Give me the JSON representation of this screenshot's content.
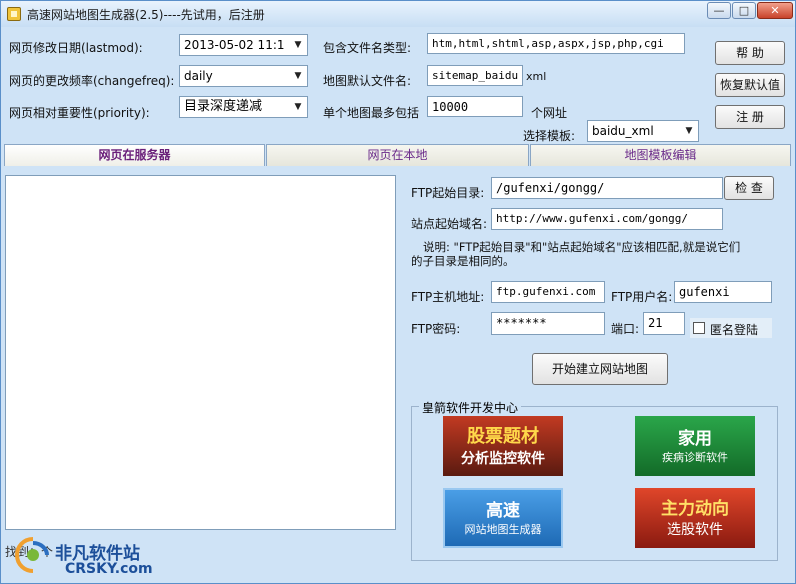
{
  "window": {
    "title": "高速网站地图生成器(2.5)----先试用，后注册",
    "min_glyph": "—",
    "max_glyph": "□",
    "close_glyph": "✕"
  },
  "form": {
    "lastmod_label": "网页修改日期(lastmod):",
    "lastmod_value": "2013-05-02 11:1",
    "changefreq_label": "网页的更改频率(changefreq):",
    "changefreq_value": "daily",
    "priority_label": "网页相对重要性(priority):",
    "priority_value": "目录深度递减",
    "include_types_label": "包含文件名类型:",
    "include_types_value": "htm,html,shtml,asp,aspx,jsp,php,cgi",
    "default_filename_label": "地图默认文件名:",
    "default_filename_value": "sitemap_baidu",
    "default_filename_ext": "xml",
    "max_urls_label": "单个地图最多包括",
    "max_urls_value": "10000",
    "max_urls_unit": "个网址",
    "template_label": "选择模板:",
    "template_value": "baidu_xml"
  },
  "side_buttons": {
    "help": "帮 助",
    "restore": "恢复默认值",
    "register": "注 册"
  },
  "tabs": [
    {
      "label": "网页在服务器"
    },
    {
      "label": "网页在本地"
    },
    {
      "label": "地图模板编辑"
    }
  ],
  "ftp": {
    "start_dir_label": "FTP起始目录:",
    "start_dir_value": "/gufenxi/gongg/",
    "check_button": "检 查",
    "site_domain_label": "站点起始域名:",
    "site_domain_value": "http://www.gufenxi.com/gongg/",
    "note_line1": "说明: \"FTP起始目录\"和\"站点起始域名\"应该相匹配,就是说它们",
    "note_line2": "的子目录是相同的。",
    "host_label": "FTP主机地址:",
    "host_value": "ftp.gufenxi.com",
    "user_label": "FTP用户名:",
    "user_value": "gufenxi",
    "password_label": "FTP密码:",
    "password_value": "*******",
    "port_label": "端口:",
    "port_value": "21",
    "anonymous_label": "匿名登陆",
    "anonymous_checked": false,
    "start_button": "开始建立网站地图"
  },
  "ads": {
    "group_title": "皇箭软件开发中心",
    "stock": {
      "line1": "股票题材",
      "line2": "分析监控软件",
      "color": "#a1281a"
    },
    "home": {
      "line1": "家用",
      "line2": "疾病诊断软件",
      "color": "#1f8f3a"
    },
    "sitemap": {
      "line1": "高速",
      "line2": "网站地图生成器",
      "color": "#2e7fc9"
    },
    "trend": {
      "line1": "主力动向",
      "line2": "选股软件",
      "color": "#c4301e"
    }
  },
  "status": {
    "text": "找到：个"
  },
  "watermark": {
    "line1": "非凡软件站",
    "line2": "CRSKY.com"
  }
}
